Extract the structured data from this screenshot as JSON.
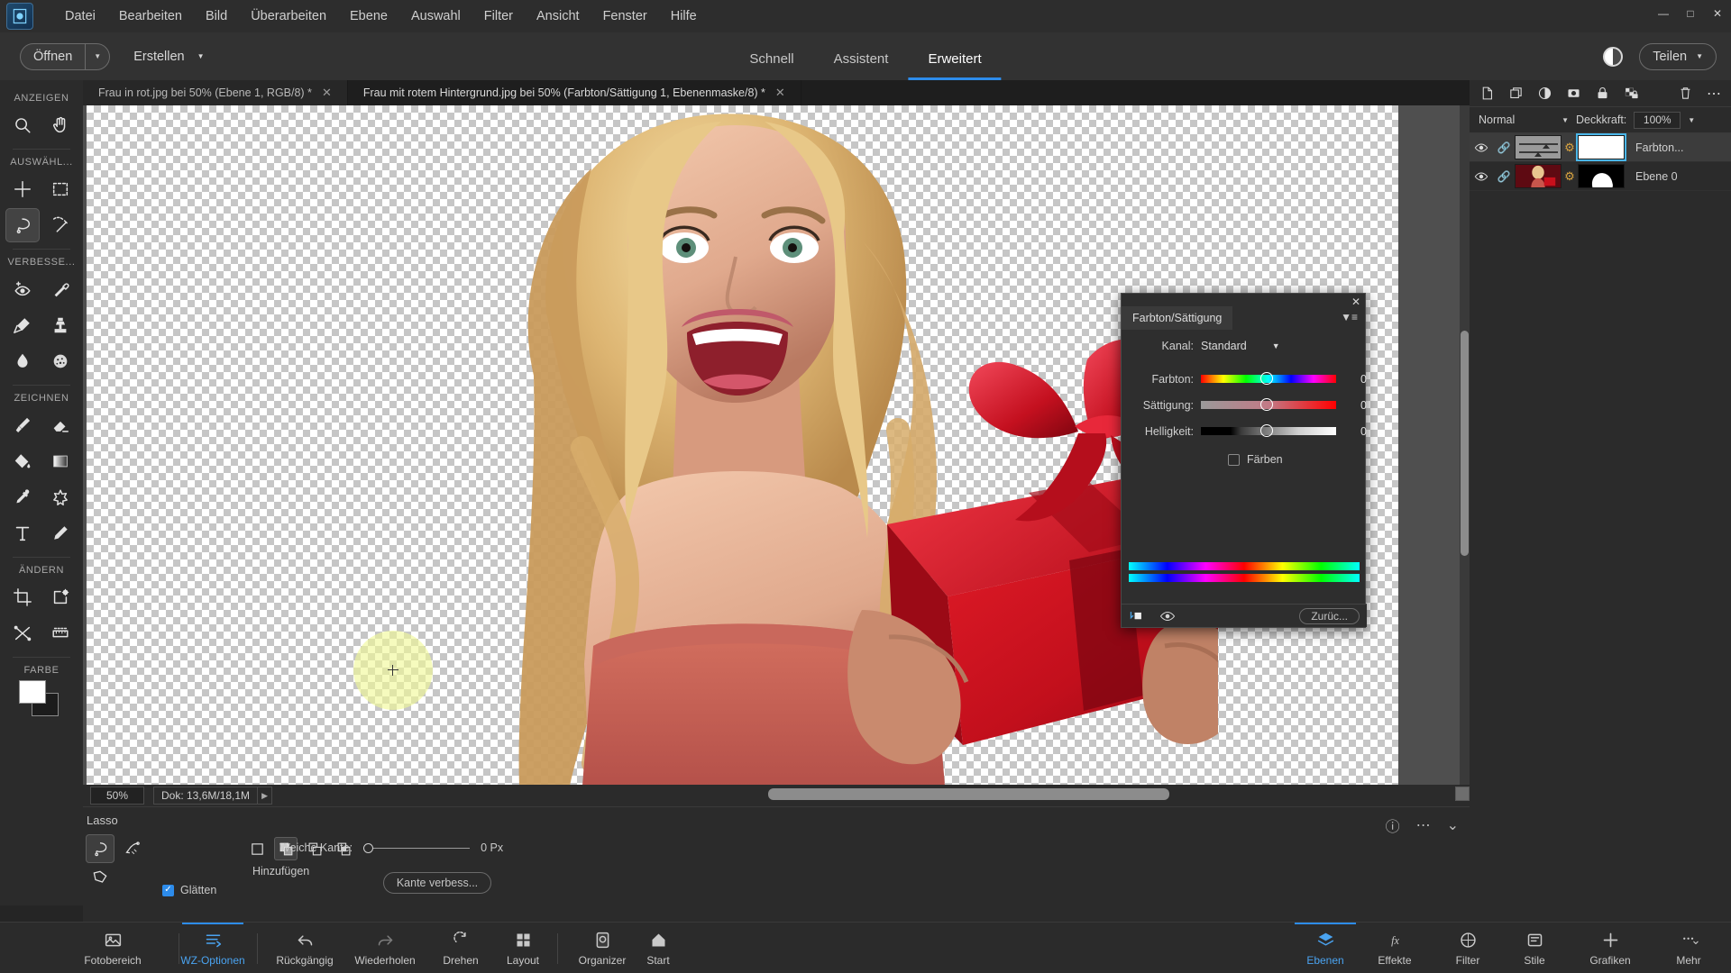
{
  "app": {
    "logo_icon": "photoshop-elements-logo",
    "menu": [
      "Datei",
      "Bearbeiten",
      "Bild",
      "Überarbeiten",
      "Ebene",
      "Auswahl",
      "Filter",
      "Ansicht",
      "Fenster",
      "Hilfe"
    ],
    "window_buttons": [
      "minimize",
      "maximize",
      "close"
    ]
  },
  "topbar": {
    "open_label": "Öffnen",
    "create_label": "Erstellen",
    "modes": [
      {
        "label": "Schnell",
        "active": false
      },
      {
        "label": "Assistent",
        "active": false
      },
      {
        "label": "Erweitert",
        "active": true
      }
    ],
    "contrast_icon": "contrast-icon",
    "share_label": "Teilen"
  },
  "tabs": [
    {
      "label": "Frau in rot.jpg bei 50% (Ebene 1, RGB/8) *",
      "active": false,
      "close_icon": "close-icon"
    },
    {
      "label": "Frau mit rotem Hintergrund.jpg bei 50% (Farbton/Sättigung 1, Ebenenmaske/8) *",
      "active": true,
      "close_icon": "close-icon"
    }
  ],
  "toolbar": {
    "sections": [
      {
        "title": "ANZEIGEN",
        "tools": [
          {
            "name": "zoom-tool",
            "icon": "magnifier-icon",
            "active": false
          },
          {
            "name": "hand-tool",
            "icon": "hand-icon",
            "active": false
          }
        ]
      },
      {
        "title": "AUSWÄHL...",
        "tools": [
          {
            "name": "move-tool",
            "icon": "move-icon",
            "active": false
          },
          {
            "name": "rectangular-marquee-tool",
            "icon": "marquee-icon",
            "active": false
          },
          {
            "name": "lasso-tool",
            "icon": "lasso-icon",
            "active": true
          },
          {
            "name": "magic-wand-tool",
            "icon": "magic-wand-icon",
            "active": false
          }
        ]
      },
      {
        "title": "VERBESSE...",
        "tools": [
          {
            "name": "red-eye-tool",
            "icon": "eye-plus-icon",
            "active": false
          },
          {
            "name": "spot-healing-tool",
            "icon": "healing-brush-icon",
            "active": false
          },
          {
            "name": "smart-brush-tool",
            "icon": "paintbrush-stroke-icon",
            "active": false
          },
          {
            "name": "clone-stamp-tool",
            "icon": "stamp-icon",
            "active": false
          },
          {
            "name": "blur-tool",
            "icon": "droplet-icon",
            "active": false
          },
          {
            "name": "sponge-tool",
            "icon": "sponge-icon",
            "active": false
          }
        ]
      },
      {
        "title": "ZEICHNEN",
        "tools": [
          {
            "name": "brush-tool",
            "icon": "brush-icon",
            "active": false
          },
          {
            "name": "eraser-tool",
            "icon": "eraser-icon",
            "active": false
          },
          {
            "name": "paint-bucket-tool",
            "icon": "paint-bucket-icon",
            "active": false
          },
          {
            "name": "gradient-tool",
            "icon": "gradient-icon",
            "active": false
          },
          {
            "name": "eyedropper-tool",
            "icon": "eyedropper-icon",
            "active": false
          },
          {
            "name": "custom-shape-tool",
            "icon": "star-shape-icon",
            "active": false
          },
          {
            "name": "type-tool",
            "icon": "text-t-icon",
            "active": false
          },
          {
            "name": "pencil-tool",
            "icon": "pencil-icon",
            "active": false
          }
        ]
      },
      {
        "title": "ÄNDERN",
        "tools": [
          {
            "name": "crop-tool",
            "icon": "crop-icon",
            "active": false
          },
          {
            "name": "content-aware-move-tool",
            "icon": "frame-gear-icon",
            "active": false
          },
          {
            "name": "recompose-tool",
            "icon": "recompose-icon",
            "active": false
          },
          {
            "name": "straighten-tool",
            "icon": "straighten-icon",
            "active": false
          }
        ]
      }
    ],
    "color_section_title": "FARBE",
    "foreground_color": "#ffffff",
    "background_color": "#1c1c1c"
  },
  "canvas": {
    "zoom_value": "50%",
    "doc_info": "Dok: 13,6M/18,1M",
    "doc_arrow": "chevron-right-icon",
    "brush_cursor": "circular-brush-cursor"
  },
  "options": {
    "tool_title": "Lasso",
    "lasso_variants": [
      {
        "name": "lasso-variant",
        "icon": "lasso-icon",
        "active": true
      },
      {
        "name": "magnetic-lasso-variant",
        "icon": "magnetic-lasso-icon",
        "active": false
      },
      {
        "name": "polygonal-lasso-variant",
        "icon": "polygonal-lasso-icon",
        "active": false
      }
    ],
    "selection_modes": [
      {
        "name": "new-selection",
        "icon": "square-icon",
        "active": false
      },
      {
        "name": "add-to-selection",
        "icon": "add-squares-icon",
        "active": true
      },
      {
        "name": "subtract-from-selection",
        "icon": "subtract-squares-icon",
        "active": false
      },
      {
        "name": "intersect-selection",
        "icon": "intersect-squares-icon",
        "active": false
      }
    ],
    "selection_mode_label": "Hinzufügen",
    "smooth_label": "Glätten",
    "smooth_checked": true,
    "feather_label": "Weiche Kante:",
    "feather_value": "0 Px",
    "refine_edge_label": "Kante verbess...",
    "help_icon": "question-circle-icon",
    "more_icon": "ellipsis-icon",
    "collapse_icon": "chevron-down-icon"
  },
  "bottom_nav": [
    {
      "label": "Fotobereich",
      "icon": "photo-bin-icon",
      "active": false
    },
    {
      "label": "WZ-Optionen",
      "icon": "tool-options-icon",
      "active": true
    },
    {
      "label": "Rückgängig",
      "icon": "undo-arrow-icon",
      "active": false
    },
    {
      "label": "Wiederholen",
      "icon": "redo-arrow-icon",
      "active": false
    },
    {
      "label": "Drehen",
      "icon": "rotate-icon",
      "active": false
    },
    {
      "label": "Layout",
      "icon": "grid-layout-icon",
      "active": false
    },
    {
      "label": "Organizer",
      "icon": "organizer-icon",
      "active": false
    },
    {
      "label": "Start",
      "icon": "home-icon",
      "active": false
    },
    {
      "label": "Ebenen",
      "icon": "layers-icon",
      "active": true
    },
    {
      "label": "Effekte",
      "icon": "fx-icon",
      "active": false
    },
    {
      "label": "Filter",
      "icon": "filter-circle-icon",
      "active": false
    },
    {
      "label": "Stile",
      "icon": "styles-icon",
      "active": false
    },
    {
      "label": "Grafiken",
      "icon": "plus-icon",
      "active": false
    },
    {
      "label": "Mehr",
      "icon": "ellipsis-chevron-icon",
      "active": false
    }
  ],
  "layers_panel": {
    "toolbar_icons": [
      {
        "name": "new-layer-icon",
        "icon": "page-icon"
      },
      {
        "name": "duplicate-layer-icon",
        "icon": "copy-icon"
      },
      {
        "name": "adjustment-layer-icon",
        "icon": "half-circle-icon"
      },
      {
        "name": "layer-mask-icon",
        "icon": "mask-icon"
      },
      {
        "name": "lock-layer-icon",
        "icon": "lock-icon"
      },
      {
        "name": "lock-transparency-icon",
        "icon": "checker-lock-icon"
      },
      {
        "name": "delete-layer-icon",
        "icon": "trash-icon"
      },
      {
        "name": "panel-menu-icon",
        "icon": "ellipsis-icon"
      }
    ],
    "blend_mode": "Normal",
    "opacity_label": "Deckkraft:",
    "opacity_value": "100%",
    "layers": [
      {
        "name": "Farbton...",
        "visible": true,
        "selected": true,
        "thumb_type": "adjustment",
        "mask_type": "white",
        "mask_selected": true,
        "eye_icon": "eye-icon",
        "link_icon": "link-icon",
        "chain_icon": "chain-icon"
      },
      {
        "name": "Ebene 0",
        "visible": true,
        "selected": false,
        "thumb_type": "photo",
        "mask_type": "shape",
        "mask_selected": false,
        "eye_icon": "eye-icon",
        "link_icon": "link-icon",
        "chain_icon": "chain-icon"
      }
    ]
  },
  "dialog": {
    "title": "Farbton/Sättigung",
    "close_icon": "close-icon",
    "menu_icon": "panel-menu-icon",
    "channel_label": "Kanal:",
    "channel_value": "Standard",
    "channel_caret": "chevron-down-icon",
    "sliders": [
      {
        "label": "Farbton:",
        "value": "0",
        "type": "hue"
      },
      {
        "label": "Sättigung:",
        "value": "0",
        "type": "saturation"
      },
      {
        "label": "Helligkeit:",
        "value": "0",
        "type": "lightness"
      }
    ],
    "colorize_label": "Färben",
    "colorize_checked": false,
    "footer_icons": [
      {
        "name": "clip-to-layer-icon",
        "icon": "clip-icon"
      },
      {
        "name": "preview-eye-icon",
        "icon": "eye-icon"
      }
    ],
    "reset_label": "Zurüc..."
  },
  "colors": {
    "accent": "#2d8ceb",
    "panel_bg": "#2b2b2b",
    "titlebar_bg": "#2d2d2d",
    "canvas_bg": "#4f4f4f",
    "mask_highlight": "#4ab6e8",
    "chain_gold": "#d9a441"
  }
}
